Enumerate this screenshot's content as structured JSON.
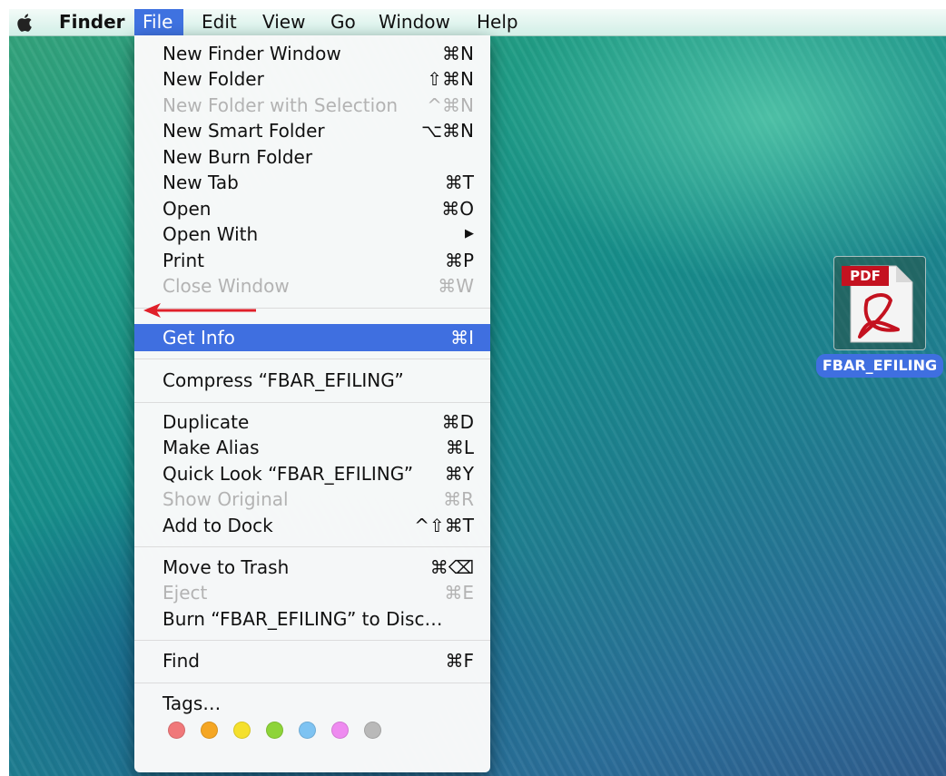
{
  "menubar": {
    "app_name": "Finder",
    "items": [
      "File",
      "Edit",
      "View",
      "Go",
      "Window",
      "Help"
    ],
    "active_item": "File"
  },
  "file_menu": {
    "items": [
      {
        "label": "New Finder Window",
        "shortcut": "⌘N",
        "enabled": true
      },
      {
        "label": "New Folder",
        "shortcut": "⇧⌘N",
        "enabled": true
      },
      {
        "label": "New Folder with Selection",
        "shortcut": "^⌘N",
        "enabled": false
      },
      {
        "label": "New Smart Folder",
        "shortcut": "⌥⌘N",
        "enabled": true
      },
      {
        "label": "New Burn Folder",
        "shortcut": "",
        "enabled": true
      },
      {
        "label": "New Tab",
        "shortcut": "⌘T",
        "enabled": true
      },
      {
        "label": "Open",
        "shortcut": "⌘O",
        "enabled": true
      },
      {
        "label": "Open With",
        "shortcut": "▶",
        "enabled": true
      },
      {
        "label": "Print",
        "shortcut": "⌘P",
        "enabled": true
      },
      {
        "label": "Close Window",
        "shortcut": "⌘W",
        "enabled": false
      },
      {
        "label": "Get Info",
        "shortcut": "⌘I",
        "enabled": true,
        "highlighted": true
      },
      {
        "label": "Compress “FBAR_EFILING”",
        "shortcut": "",
        "enabled": true
      },
      {
        "label": "Duplicate",
        "shortcut": "⌘D",
        "enabled": true
      },
      {
        "label": "Make Alias",
        "shortcut": "⌘L",
        "enabled": true
      },
      {
        "label": "Quick Look “FBAR_EFILING”",
        "shortcut": "⌘Y",
        "enabled": true
      },
      {
        "label": "Show Original",
        "shortcut": "⌘R",
        "enabled": false
      },
      {
        "label": "Add to Dock",
        "shortcut": "^⇧⌘T",
        "enabled": true
      },
      {
        "label": "Move to Trash",
        "shortcut": "⌘⌫",
        "enabled": true
      },
      {
        "label": "Eject",
        "shortcut": "⌘E",
        "enabled": false
      },
      {
        "label": "Burn “FBAR_EFILING” to Disc…",
        "shortcut": "",
        "enabled": true
      },
      {
        "label": "Find",
        "shortcut": "⌘F",
        "enabled": true
      },
      {
        "label": "Tags…",
        "shortcut": "",
        "enabled": true
      }
    ],
    "tag_colors": [
      "#f0787a",
      "#f5a623",
      "#f5e02c",
      "#8ed439",
      "#7ec3f2",
      "#ee8bf0",
      "#b9b9b9"
    ]
  },
  "desktop": {
    "file_icon_badge": "PDF",
    "file_name": "FBAR_EFILING"
  },
  "colors": {
    "highlight": "#3f6fe0",
    "annotation_arrow": "#e0202a"
  }
}
